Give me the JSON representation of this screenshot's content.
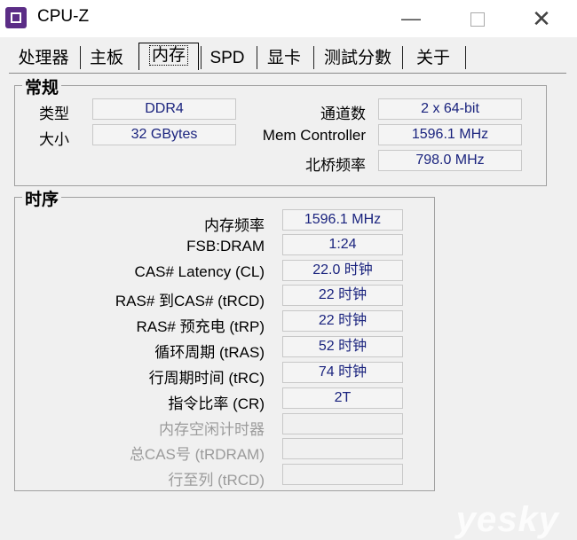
{
  "window": {
    "title": "CPU-Z",
    "minimize": "—",
    "close": "✕"
  },
  "tabs": [
    "处理器",
    "主板",
    "内存",
    "SPD",
    "显卡",
    "测試分數",
    "关于"
  ],
  "general": {
    "title": "常规",
    "type_label": "类型",
    "type_value": "DDR4",
    "size_label": "大小",
    "size_value": "32 GBytes",
    "channels_label": "通道数",
    "channels_value": "2 x 64-bit",
    "mem_controller_label": "Mem Controller",
    "mem_controller_value": "1596.1 MHz",
    "nb_freq_label": "北桥频率",
    "nb_freq_value": "798.0 MHz"
  },
  "timings": {
    "title": "时序",
    "rows": [
      {
        "label": "内存频率",
        "value": "1596.1 MHz"
      },
      {
        "label": "FSB:DRAM",
        "value": "1:24"
      },
      {
        "label": "CAS# Latency (CL)",
        "value": "22.0 时钟"
      },
      {
        "label": "RAS# 到CAS# (tRCD)",
        "value": "22 时钟"
      },
      {
        "label": "RAS# 预充电 (tRP)",
        "value": "22 时钟"
      },
      {
        "label": "循环周期 (tRAS)",
        "value": "52 时钟"
      },
      {
        "label": "行周期时间 (tRC)",
        "value": "74 时钟"
      },
      {
        "label": "指令比率 (CR)",
        "value": "2T"
      },
      {
        "label": "内存空闲计时器",
        "value": ""
      },
      {
        "label": "总CAS号 (tRDRAM)",
        "value": ""
      },
      {
        "label": "行至列 (tRCD)",
        "value": ""
      }
    ]
  },
  "watermark": "yesky"
}
